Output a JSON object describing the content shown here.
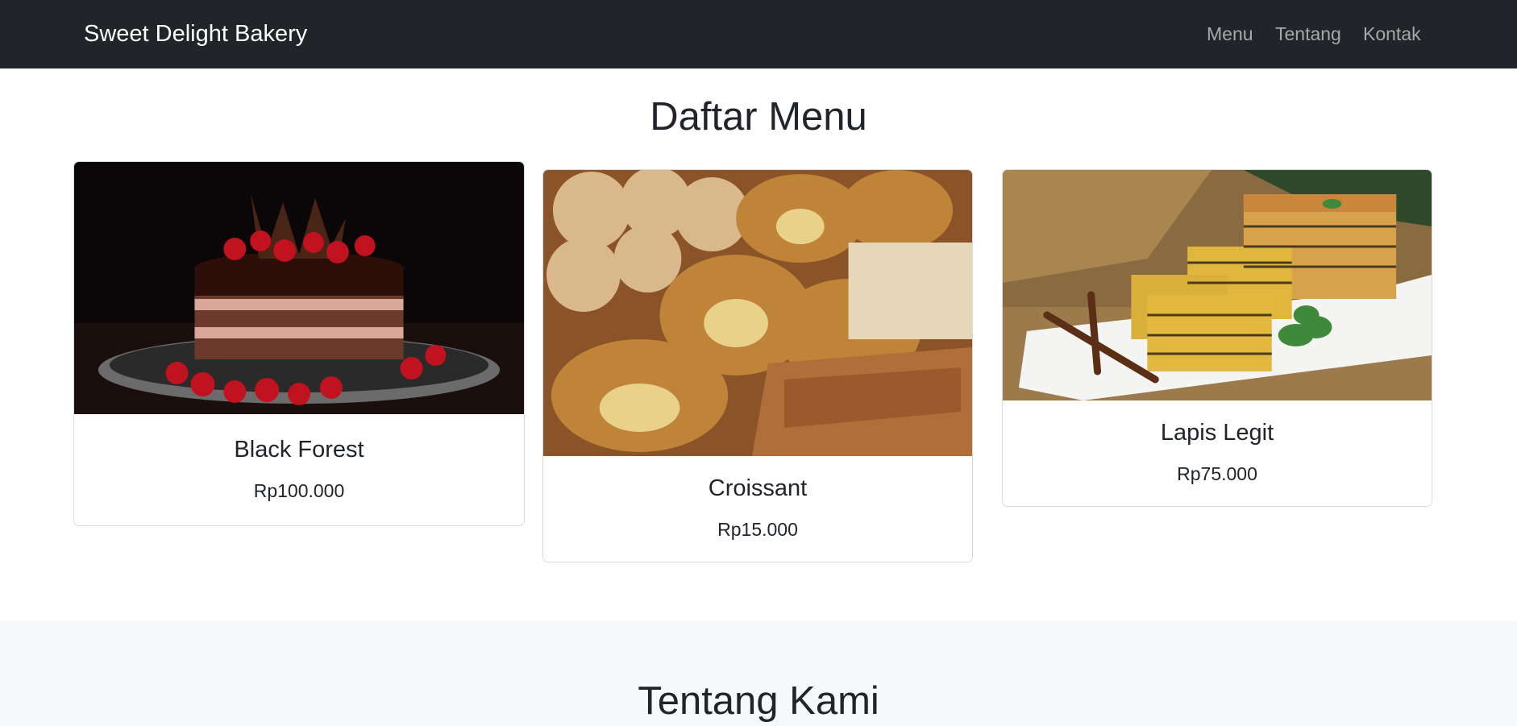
{
  "navbar": {
    "brand": "Sweet Delight Bakery",
    "links": [
      "Menu",
      "Tentang",
      "Kontak"
    ]
  },
  "menu_section": {
    "title": "Daftar Menu",
    "items": [
      {
        "name": "Black Forest",
        "price": "Rp100.000",
        "image": "black-forest-cake-photo"
      },
      {
        "name": "Croissant",
        "price": "Rp15.000",
        "image": "croissant-pastries-photo"
      },
      {
        "name": "Lapis Legit",
        "price": "Rp75.000",
        "image": "lapis-legit-cake-photo"
      }
    ]
  },
  "about_section": {
    "title": "Tentang Kami"
  },
  "colors": {
    "navbar_bg": "#212529",
    "nav_link": "#a7a8aa",
    "text": "#212529",
    "about_bg": "#f8f9fa"
  }
}
